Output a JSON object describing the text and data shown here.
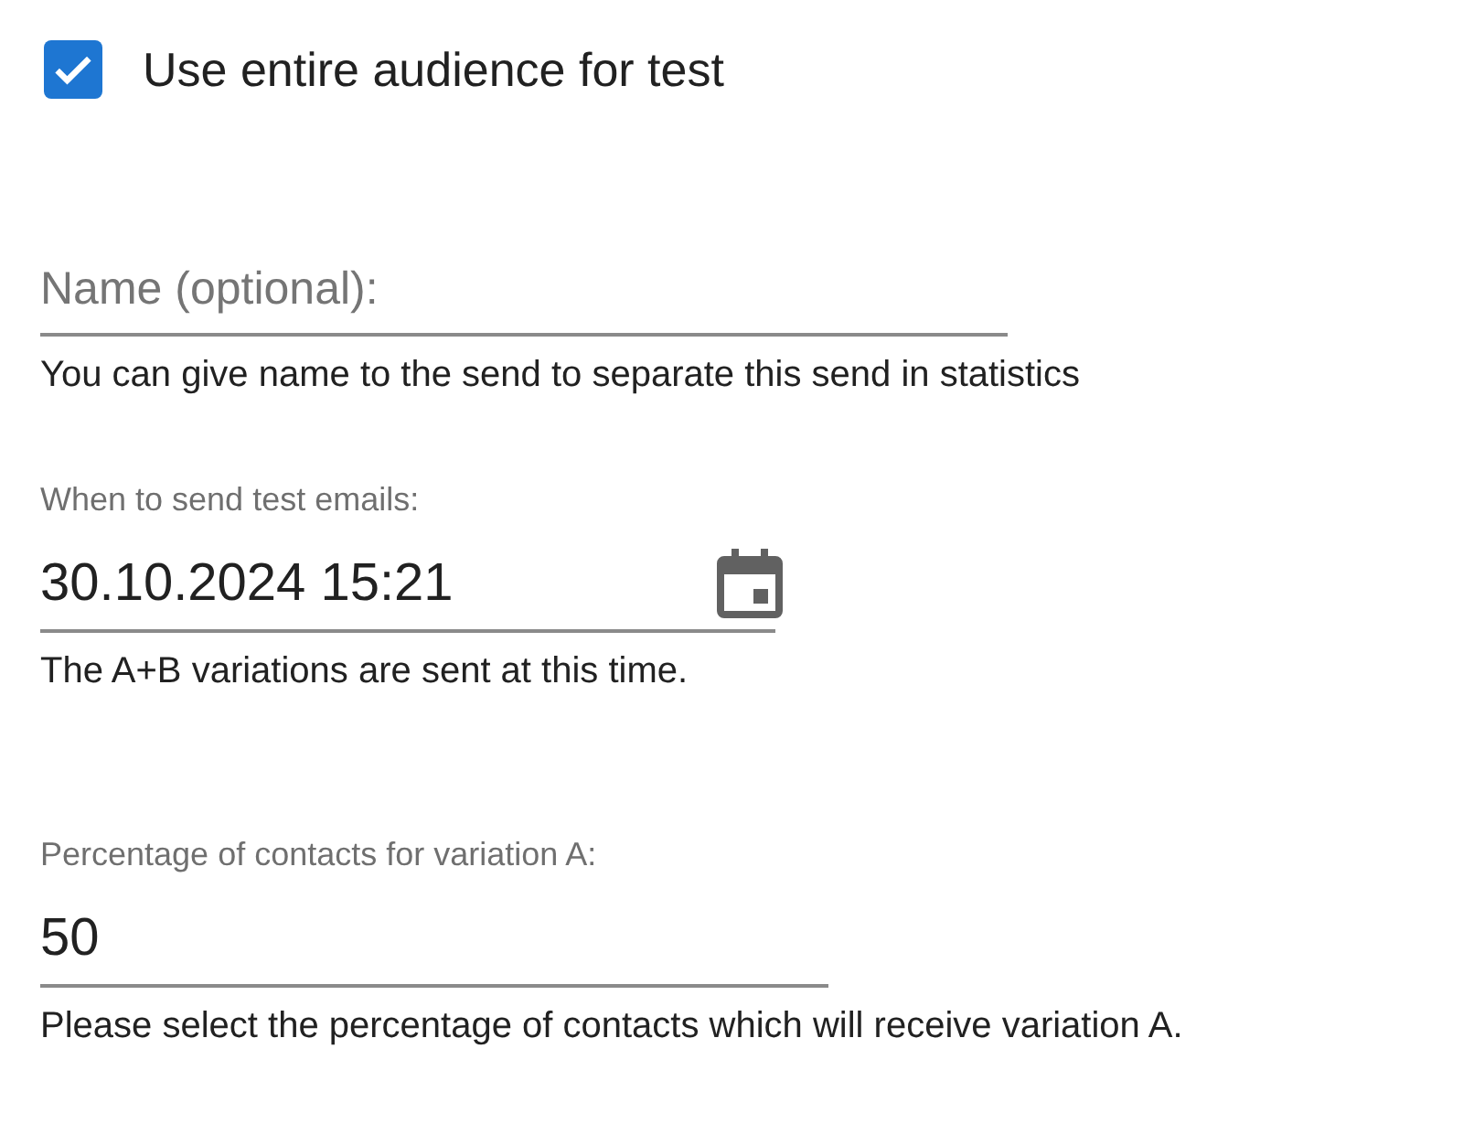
{
  "checkbox": {
    "label": "Use entire audience for test",
    "checked": true
  },
  "fields": [
    {
      "kind": "text",
      "placeholder": "Name (optional):",
      "help": "You can give name to the send to separate this send in statistics"
    },
    {
      "kind": "datetime",
      "label": "When to send test emails:",
      "value": "30.10.2024 15:21",
      "help": "The A+B variations are sent at this time."
    },
    {
      "kind": "number",
      "label": "Percentage of contacts for variation A:",
      "value": "50",
      "help": "Please select the percentage of contacts which will receive variation A."
    }
  ]
}
